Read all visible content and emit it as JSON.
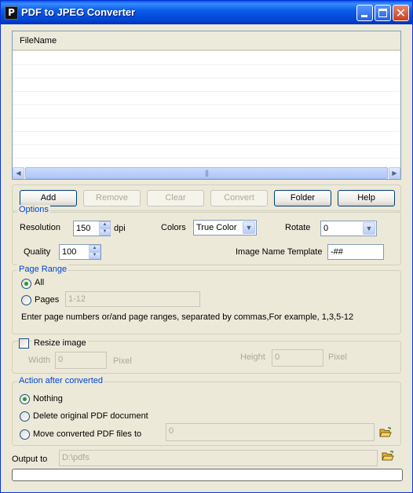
{
  "window": {
    "title": "PDF to JPEG Converter"
  },
  "file_list": {
    "column_header": "FileName",
    "scroll_thumb": "|||"
  },
  "buttons": {
    "add": "Add",
    "remove": "Remove",
    "clear": "Clear",
    "convert": "Convert",
    "folder": "Folder",
    "help": "Help"
  },
  "options": {
    "title": "Options",
    "resolution_label": "Resolution",
    "resolution_value": "150",
    "resolution_unit": "dpi",
    "colors_label": "Colors",
    "colors_value": "True Color",
    "rotate_label": "Rotate",
    "rotate_value": "0",
    "quality_label": "Quality",
    "quality_value": "100",
    "template_label": "Image Name Template",
    "template_value": "-##"
  },
  "page_range": {
    "title": "Page Range",
    "all_label": "All",
    "pages_label": "Pages",
    "pages_value": "1-12",
    "hint": "Enter page numbers or/and page ranges, separated by commas,For example, 1,3,5-12",
    "selected": "All"
  },
  "resize": {
    "checkbox_label": "Resize image",
    "checked": false,
    "width_label": "Width",
    "width_value": "0",
    "width_unit": "Pixel",
    "height_label": "Height",
    "height_value": "0",
    "height_unit": "Pixel"
  },
  "action": {
    "title": "Action after converted",
    "nothing_label": "Nothing",
    "delete_label": "Delete original PDF document",
    "move_label": "Move converted PDF files to",
    "move_path": "0",
    "selected": "Nothing"
  },
  "output": {
    "label": "Output to",
    "path": "D:\\pdfs"
  },
  "progress": {
    "percent": 0
  },
  "colors": {
    "title_bar": "#0a5ee9",
    "group_title": "#0046d5",
    "window_bg": "#ece9d8"
  }
}
